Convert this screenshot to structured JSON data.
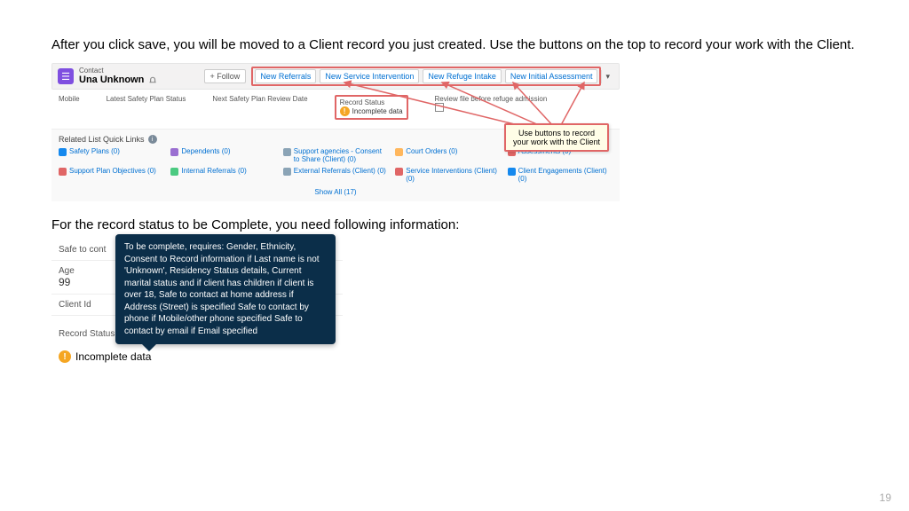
{
  "intro": "After you click save, you will be moved to a Client record you just created. Use the buttons on the top to record your work with the Client.",
  "header": {
    "type_label": "Contact",
    "name": "Una Unknown",
    "follow": "+  Follow",
    "buttons": [
      "New Referrals",
      "New Service Intervention",
      "New Refuge Intake",
      "New Initial Assessment"
    ]
  },
  "fields": {
    "mobile": "Mobile",
    "latest": "Latest Safety Plan Status",
    "next": "Next Safety Plan Review Date",
    "status_label": "Record Status",
    "status_value": "Incomplete data",
    "review": "Review file before refuge admission"
  },
  "callout": "Use buttons to record your work with the Client",
  "related": {
    "title": "Related List Quick Links",
    "row1": [
      "Safety Plans (0)",
      "Dependents (0)",
      "Support agencies - Consent to Share (Client) (0)",
      "Court Orders (0)",
      "Assessments (0)"
    ],
    "row2": [
      "Support Plan Objectives (0)",
      "Internal Referrals (0)",
      "External Referrals (Client) (0)",
      "Service Interventions (Client) (0)",
      "Client Engagements (Client) (0)"
    ],
    "showall": "Show All (17)"
  },
  "para2": "For the record status to be Complete, you need following information:",
  "s2": {
    "safe": "Safe to cont",
    "age_label": "Age",
    "age_value": "99",
    "clientid_label": "Client Id",
    "rs_label": "Record Status",
    "rs_value": "Incomplete data",
    "tooltip": "To be complete, requires: Gender, Ethnicity,  Consent to Record information if Last name is not 'Unknown', Residency Status details, Current marital status and if client has children if client is over 18,  Safe to contact at home address if Address (Street) is specified Safe to contact by phone if Mobile/other phone specified Safe to contact by email if Email specified"
  },
  "page": "19"
}
